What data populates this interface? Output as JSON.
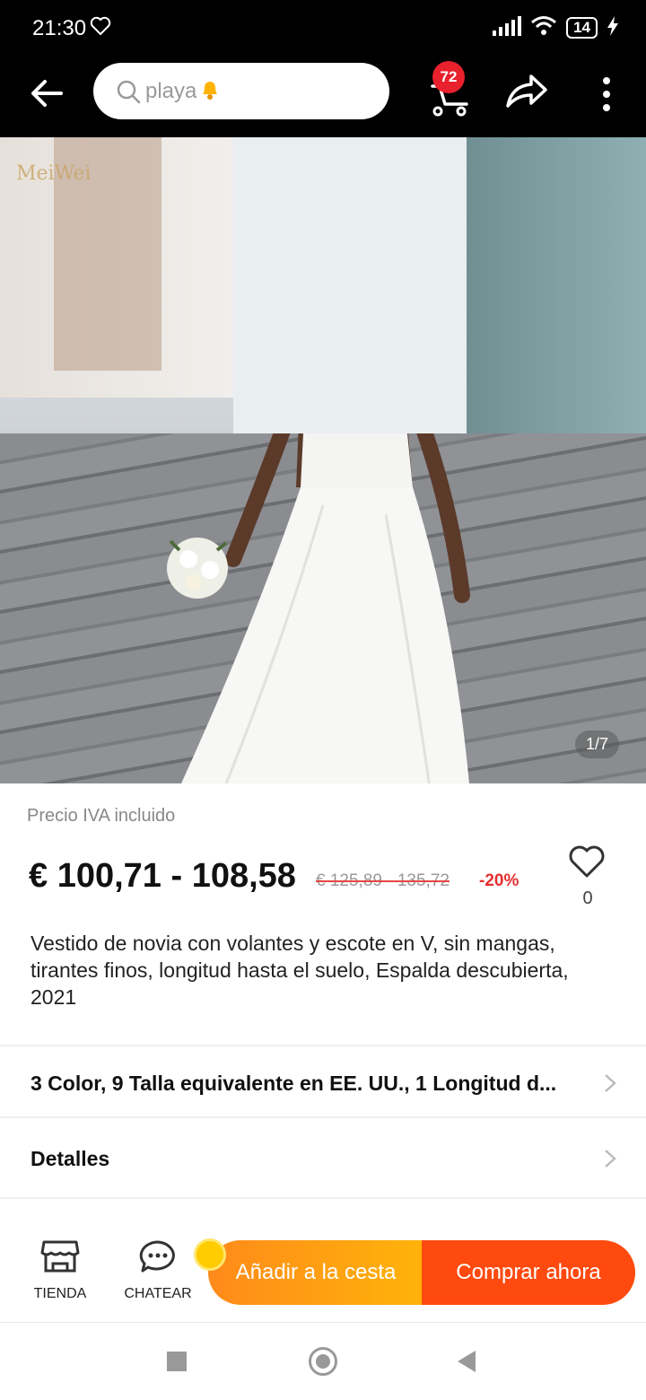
{
  "status_bar": {
    "time": "21:30",
    "battery": "14"
  },
  "top_bar": {
    "search_placeholder": "playa",
    "cart_count": "72"
  },
  "product_image": {
    "logo_text": "MeiWei",
    "counter": "1/7"
  },
  "price": {
    "note": "Precio IVA incluido",
    "current": "€ 100,71 - 108,58",
    "original": "€ 125,89 - 135,72",
    "discount": "-20%",
    "wishlist_count": "0"
  },
  "product": {
    "title": "Vestido de novia con volantes y escote en V, sin mangas, tirantes finos, longitud hasta el suelo, Espalda descubierta, 2021"
  },
  "options_row": {
    "label": "3 Color, 9 Talla equivalente en EE. UU., 1 Longitud d..."
  },
  "details_row": {
    "label": "Detalles"
  },
  "action_bar": {
    "store_label": "TIENDA",
    "chat_label": "CHATEAR",
    "add_to_cart_label": "Añadir a la cesta",
    "buy_now_label": "Comprar ahora"
  },
  "colors": {
    "accent_orange": "#ff8a1a",
    "buy_red": "#ff4a0f",
    "discount_red": "#e62e2e",
    "badge_red": "#e8212d"
  }
}
